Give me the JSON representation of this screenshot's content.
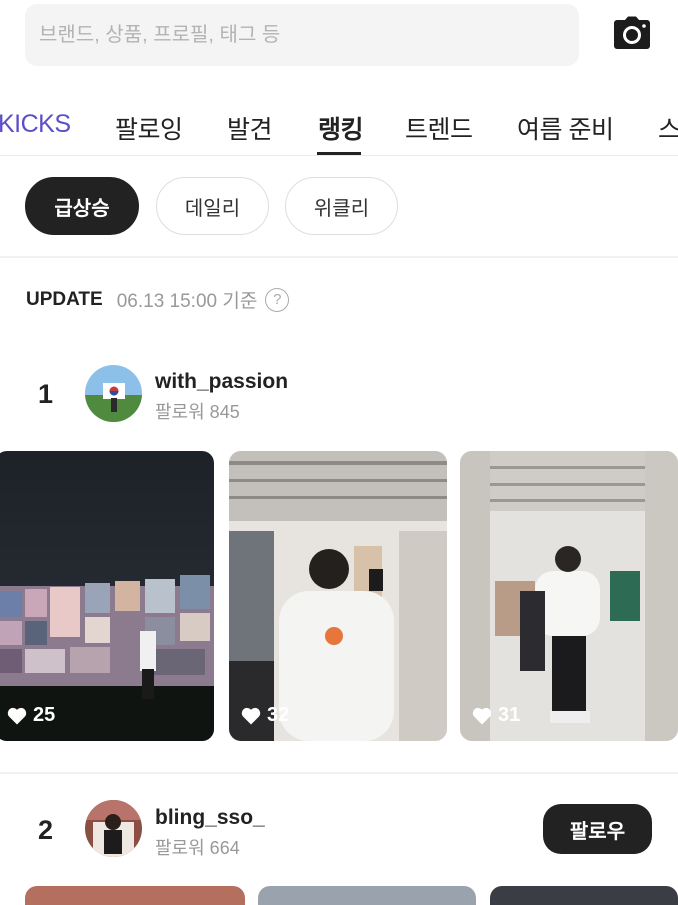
{
  "search": {
    "placeholder": "브랜드, 상품, 프로필, 태그 등"
  },
  "tabs": [
    {
      "label": "KICKS"
    },
    {
      "label": "팔로잉"
    },
    {
      "label": "발견"
    },
    {
      "label": "랭킹"
    },
    {
      "label": "트렌드"
    },
    {
      "label": "여름 준비"
    },
    {
      "label": "스"
    }
  ],
  "active_tab": "랭킹",
  "chips": [
    {
      "label": "급상승"
    },
    {
      "label": "데일리"
    },
    {
      "label": "위클리"
    }
  ],
  "active_chip": "급상승",
  "update": {
    "label": "UPDATE",
    "time": "06.13 15:00 기준",
    "help_icon": "?"
  },
  "rankings": [
    {
      "rank": "1",
      "username": "with_passion",
      "followers": "팔로워 845",
      "posts": [
        {
          "likes": "25"
        },
        {
          "likes": "32"
        },
        {
          "likes": "31"
        }
      ]
    },
    {
      "rank": "2",
      "username": "bling_sso_",
      "followers": "팔로워 664",
      "follow_label": "팔로우"
    }
  ],
  "icons": {
    "camera": "camera-icon",
    "heart": "heart-icon",
    "help": "help-icon"
  },
  "colors": {
    "brand_tab": "#5b4fc9",
    "chip_active": "#222222",
    "follow_button": "#222222"
  }
}
